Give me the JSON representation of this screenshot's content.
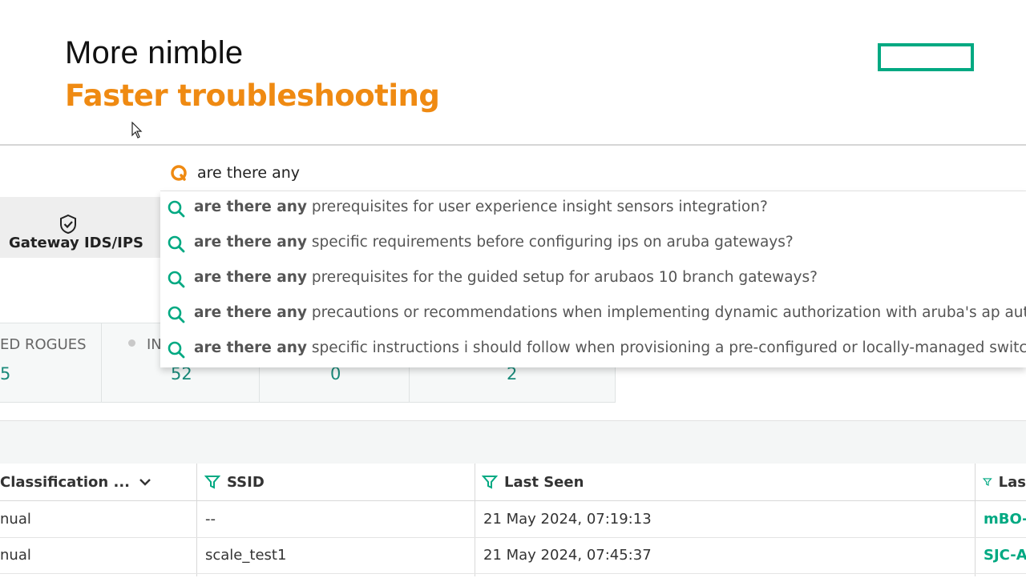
{
  "slide": {
    "title": "More nimble",
    "subtitle": "Faster troubleshooting",
    "accent_color": "#ef8a12",
    "logo_color": "#01a982"
  },
  "search": {
    "value": "are there any",
    "suggestions": [
      {
        "bold": "are there any",
        "rest": " prerequisites for user experience insight sensors integration?"
      },
      {
        "bold": "are there any",
        "rest": " specific requirements before configuring ips on aruba gateways?"
      },
      {
        "bold": "are there any",
        "rest": " prerequisites for the guided setup for arubaos 10 branch gateways?"
      },
      {
        "bold": "are there any",
        "rest": " precautions or recommendations when implementing dynamic authorization with aruba's ap authe"
      },
      {
        "bold": "are there any",
        "rest": " specific instructions i should follow when provisioning a pre-configured or locally-managed switch in"
      }
    ]
  },
  "gateway_tile": {
    "label": "Gateway IDS/IPS",
    "icon": "shield-check-icon"
  },
  "stats": [
    {
      "label": "ED ROGUES",
      "value": "5"
    },
    {
      "label": "IN",
      "value": "52"
    },
    {
      "label": "",
      "value": "0"
    },
    {
      "label": "",
      "value": "2"
    }
  ],
  "table": {
    "columns": [
      "Classification ...",
      "SSID",
      "Last Seen",
      "Las"
    ],
    "rows": [
      {
        "classification": "nual",
        "ssid": "--",
        "last_seen": "21 May 2024, 07:19:13",
        "last": "mBO-"
      },
      {
        "classification": "nual",
        "ssid": "scale_test1",
        "last_seen": "21 May 2024, 07:45:37",
        "last": "SJC-AF"
      }
    ]
  }
}
